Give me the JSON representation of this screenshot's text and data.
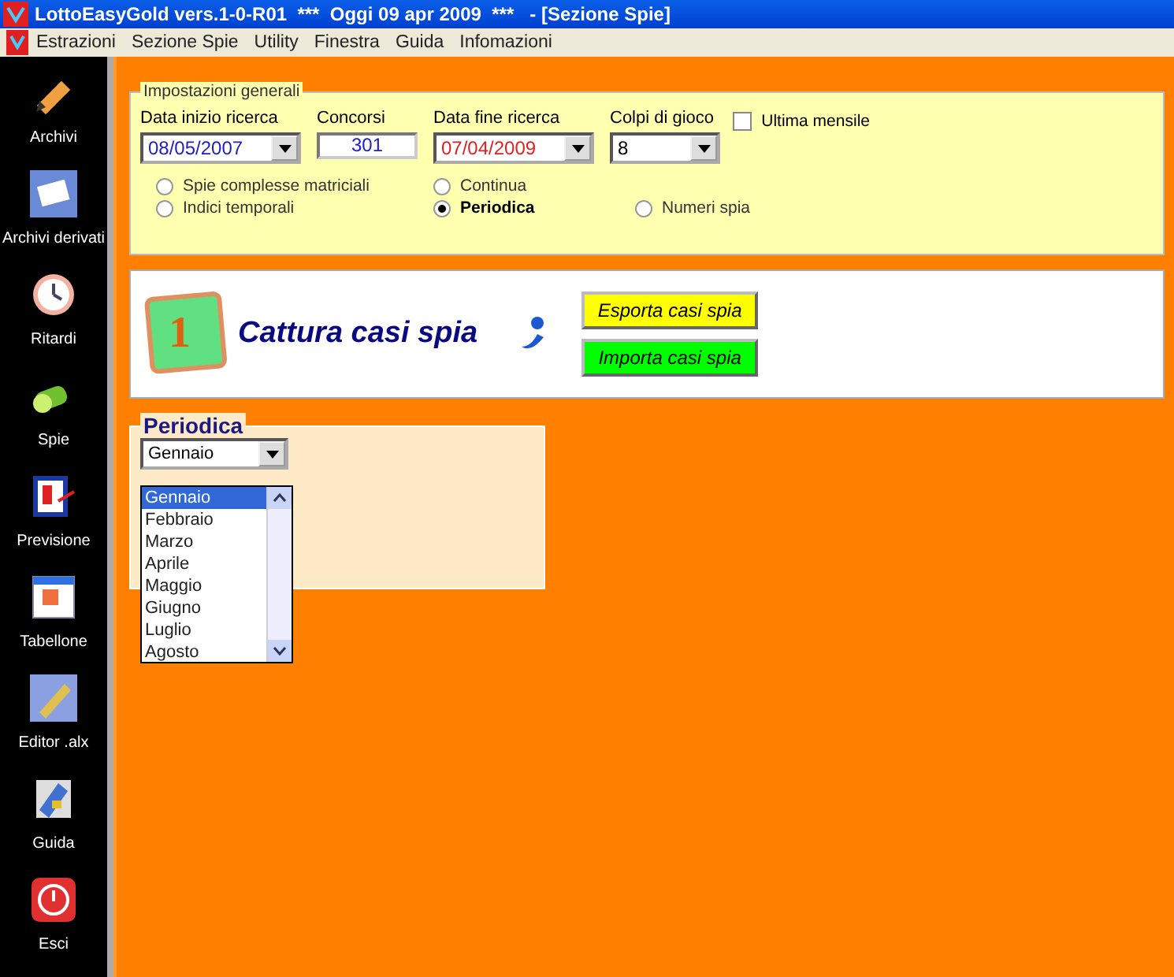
{
  "window": {
    "title": "LottoEasyGold vers.1-0-R01  ***  Oggi 09 apr 2009  ***   - [Sezione Spie]"
  },
  "menu": [
    "Estrazioni",
    "Sezione Spie",
    "Utility",
    "Finestra",
    "Guida",
    "Infomazioni"
  ],
  "sidebar": {
    "items": [
      {
        "label": "Archivi"
      },
      {
        "label": "Archivi derivati"
      },
      {
        "label": "Ritardi"
      },
      {
        "label": "Spie"
      },
      {
        "label": "Previsione"
      },
      {
        "label": "Tabellone"
      },
      {
        "label": "Editor .alx"
      },
      {
        "label": "Guida"
      },
      {
        "label": "Esci"
      }
    ]
  },
  "settings": {
    "title": "Impostazioni generali",
    "fields": [
      {
        "label": "Data inizio ricerca",
        "value": "08/05/2007",
        "kind": "combo",
        "color": "#2020c0"
      },
      {
        "label": "Concorsi",
        "value": "301",
        "kind": "text",
        "color": "#2020c0"
      },
      {
        "label": "Data fine ricerca",
        "value": "07/04/2009",
        "kind": "combo",
        "color": "#e02020"
      },
      {
        "label": "Colpi di gioco",
        "value": "8",
        "kind": "combo",
        "color": "#000000"
      }
    ],
    "checkbox": {
      "label": "Ultima mensile",
      "checked": false
    },
    "radios": [
      {
        "label": "Spie complesse matriciali",
        "selected": false
      },
      {
        "label": "Continua",
        "selected": false
      },
      {
        "label": "Indici temporali",
        "selected": false
      },
      {
        "label": "Periodica",
        "selected": true
      },
      {
        "label": "Numeri spia",
        "selected": false
      }
    ]
  },
  "action_panel": {
    "step": "1",
    "title": "Cattura casi spia",
    "buttons": [
      {
        "label": "Esporta casi spia",
        "color": "#ffff00"
      },
      {
        "label": "Importa casi spia",
        "color": "#00ff00"
      }
    ]
  },
  "period_panel": {
    "title": "Periodica",
    "combo_value": "Gennaio",
    "options": [
      {
        "label": "Gennaio",
        "selected": true
      },
      {
        "label": "Febbraio",
        "selected": false
      },
      {
        "label": "Marzo",
        "selected": false
      },
      {
        "label": "Aprile",
        "selected": false
      },
      {
        "label": "Maggio",
        "selected": false
      },
      {
        "label": "Giugno",
        "selected": false
      },
      {
        "label": "Luglio",
        "selected": false
      },
      {
        "label": "Agosto",
        "selected": false
      }
    ]
  }
}
